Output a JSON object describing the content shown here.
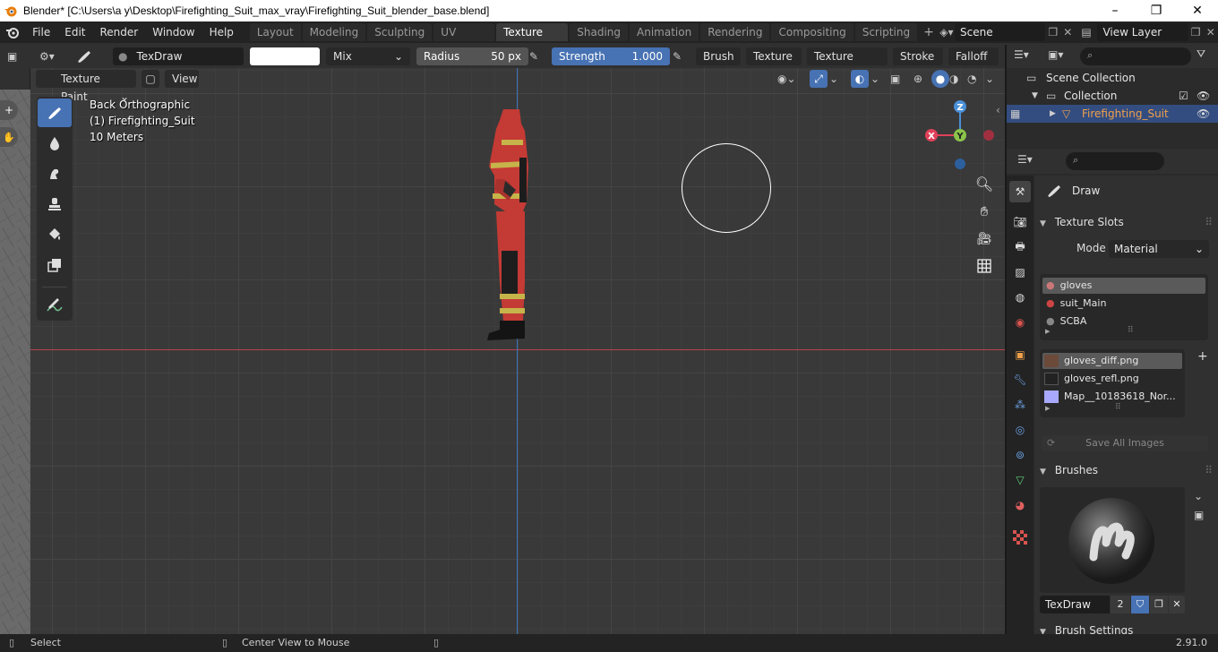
{
  "window": {
    "title": "Blender* [C:\\Users\\a y\\Desktop\\Firefighting_Suit_max_vray\\Firefighting_Suit_blender_base.blend]",
    "controls": [
      "–",
      "❐",
      "✕"
    ]
  },
  "menu": [
    "File",
    "Edit",
    "Render",
    "Window",
    "Help"
  ],
  "workspaces": [
    "Layout",
    "Modeling",
    "Sculpting",
    "UV Editing",
    "Texture Paint",
    "Shading",
    "Animation",
    "Rendering",
    "Compositing",
    "Scripting"
  ],
  "active_workspace": "Texture Paint",
  "scene": "Scene",
  "view_layer": "View Layer",
  "tool_header": {
    "brush_name": "TexDraw",
    "blend_mode": "Mix",
    "radius_label": "Radius",
    "radius_value": "50 px",
    "strength_label": "Strength",
    "strength_value": "1.000",
    "dropdowns": [
      "Brush",
      "Texture",
      "Texture Mask",
      "Stroke",
      "Falloff"
    ]
  },
  "viewport_header": {
    "mode": "Texture Paint",
    "view_menu": "View"
  },
  "viewport_overlay": {
    "view_name": "Back Orthographic",
    "object": "(1) Firefighting_Suit",
    "scale": "10 Meters"
  },
  "gizmo": {
    "z": "Z",
    "y": "Y",
    "x": "X"
  },
  "outliner": {
    "search_placeholder": "",
    "rows": [
      {
        "label": "Scene Collection"
      },
      {
        "label": "Collection"
      },
      {
        "label": "Firefighting_Suit"
      }
    ]
  },
  "properties": {
    "tool_name": "Draw",
    "texture_slots_title": "Texture Slots",
    "mode_label": "Mode",
    "mode_value": "Material",
    "materials": [
      "gloves",
      "suit_Main",
      "SCBA"
    ],
    "images": [
      "gloves_diff.png",
      "gloves_refl.png",
      "Map__10183618_Nor..."
    ],
    "save_all": "Save All Images",
    "brushes_title": "Brushes",
    "brush_name": "TexDraw",
    "brush_users": "2",
    "brush_settings_title": "Brush Settings"
  },
  "status": {
    "select": "Select",
    "center": "Center View to Mouse",
    "version": "2.91.0"
  },
  "colors": {
    "accent_blue": "#4772b3",
    "axis_red": "#e0405a",
    "axis_green": "#8bc34a",
    "axis_blue": "#4a90d9",
    "object_orange": "#f0a04b"
  }
}
